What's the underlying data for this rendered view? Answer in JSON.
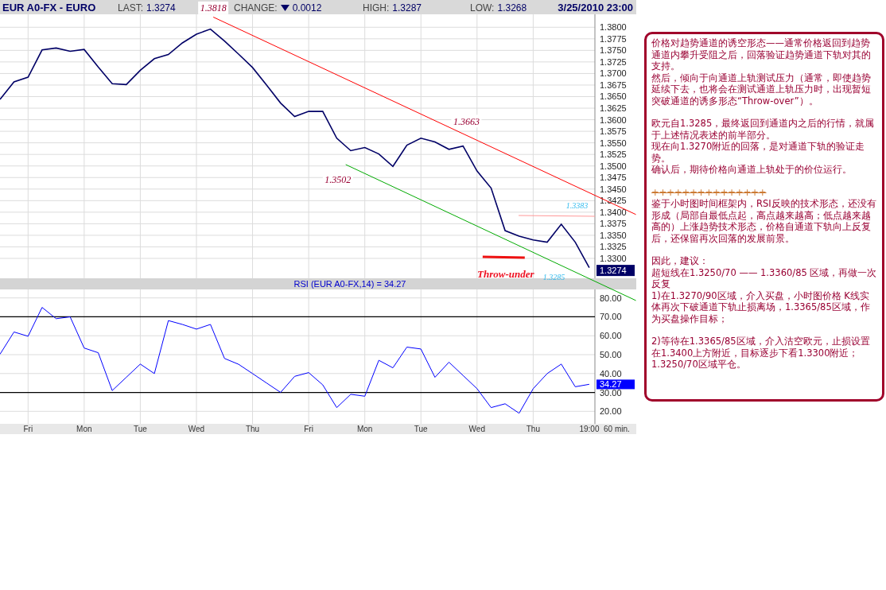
{
  "header": {
    "symbol": "EUR A0-FX - EURO",
    "last_label": "LAST:",
    "last": "1.3274",
    "change_label": "CHANGE:",
    "change": "0.0012",
    "high_label": "HIGH:",
    "high": "1.3287",
    "low_label": "LOW:",
    "low": "1.3268",
    "datetime": "3/25/2010 23:00"
  },
  "price_chart": {
    "last_value": "1.3274",
    "chart_data": {
      "type": "line",
      "categories": [
        null,
        null,
        null,
        null,
        null,
        null,
        null,
        null,
        null,
        null,
        null,
        null,
        null,
        null,
        null,
        null,
        null,
        null,
        null,
        null,
        null,
        null,
        null,
        null,
        null,
        null,
        null,
        null,
        null,
        null,
        null,
        null,
        null,
        null,
        null,
        null,
        null,
        null,
        null,
        null,
        null,
        null,
        null
      ],
      "series": [
        {
          "color": "#000066",
          "values": [
            1.3644,
            1.3682,
            1.3692,
            1.3751,
            1.3755,
            1.3748,
            1.3752,
            1.3714,
            1.3678,
            1.3676,
            1.3707,
            1.3732,
            1.3741,
            1.3766,
            1.3785,
            1.3796,
            1.377,
            1.3742,
            1.3713,
            1.3675,
            1.3636,
            1.3607,
            1.3618,
            1.3618,
            1.356,
            1.3533,
            1.354,
            1.3526,
            1.3499,
            1.3545,
            1.356,
            1.3552,
            1.3536,
            1.3543,
            1.3489,
            1.3452,
            1.336,
            1.3348,
            1.334,
            1.3335,
            1.3374,
            1.3335,
            1.328
          ]
        }
      ],
      "ylim": [
        1.3257,
        1.3828
      ],
      "grid": true,
      "yticks": [
        {
          "value": 1.33,
          "label": "1.3300"
        },
        {
          "value": 1.3325,
          "label": "1.3325"
        },
        {
          "value": 1.335,
          "label": "1.3350"
        },
        {
          "value": 1.3375,
          "label": "1.3375"
        },
        {
          "value": 1.34,
          "label": "1.3400"
        },
        {
          "value": 1.3425,
          "label": "1.3425"
        },
        {
          "value": 1.345,
          "label": "1.3450"
        },
        {
          "value": 1.3475,
          "label": "1.3475"
        },
        {
          "value": 1.35,
          "label": "1.3500"
        },
        {
          "value": 1.3525,
          "label": "1.3525"
        },
        {
          "value": 1.355,
          "label": "1.3550"
        },
        {
          "value": 1.3575,
          "label": "1.3575"
        },
        {
          "value": 1.36,
          "label": "1.3600"
        },
        {
          "value": 1.3625,
          "label": "1.3625"
        },
        {
          "value": 1.365,
          "label": "1.3650"
        },
        {
          "value": 1.3675,
          "label": "1.3675"
        },
        {
          "value": 1.37,
          "label": "1.3700"
        },
        {
          "value": 1.3725,
          "label": "1.3725"
        },
        {
          "value": 1.375,
          "label": "1.3750"
        },
        {
          "value": 1.3775,
          "label": "1.3775"
        },
        {
          "value": 1.38,
          "label": "1.3800"
        }
      ],
      "annotations": [
        "1.3818",
        "1.3663",
        "1.3502",
        "1.3383",
        "Throw-under",
        "1.3285"
      ]
    },
    "lines": [
      {
        "kind": "trend",
        "color": "#ff0000"
      },
      {
        "kind": "trend",
        "color": "#00aa00"
      },
      {
        "kind": "level",
        "color": "#ff9999"
      },
      {
        "kind": "marker",
        "color": "#ee1111"
      }
    ]
  },
  "rsi_chart": {
    "title": "RSI (EUR A0-FX,14) = 34.27",
    "last_value": "34.27",
    "chart_data": {
      "type": "line",
      "categories": [
        null,
        null,
        "Fri",
        null,
        null,
        null,
        "Mon",
        null,
        null,
        null,
        "Tue",
        null,
        null,
        null,
        "Wed",
        null,
        null,
        null,
        "Thu",
        null,
        null,
        null,
        "Fri",
        null,
        null,
        null,
        "Mon",
        null,
        null,
        null,
        "Tue",
        null,
        null,
        null,
        "Wed",
        null,
        null,
        null,
        "Thu",
        null,
        null,
        null,
        "19:00"
      ],
      "series": [
        {
          "color": "#0000ff",
          "values": [
            50.2,
            62,
            59.7,
            75,
            69,
            70,
            53.5,
            51,
            31,
            38,
            45,
            40,
            68,
            66,
            63.5,
            66,
            48,
            44.9,
            40,
            35,
            30,
            38.5,
            40.5,
            34,
            22,
            29,
            28,
            47,
            43,
            54,
            53,
            38,
            46,
            39,
            32,
            22,
            24,
            19,
            32,
            40,
            45,
            33,
            34.3
          ]
        }
      ],
      "ylim": [
        13.4,
        84.5
      ],
      "grid": true,
      "yticks": [
        {
          "value": 20,
          "label": "20.00"
        },
        {
          "value": 30,
          "label": "30.00"
        },
        {
          "value": 40,
          "label": "40.00"
        },
        {
          "value": 50,
          "label": "50.00"
        },
        {
          "value": 60,
          "label": "60.00"
        },
        {
          "value": 70,
          "label": "70.00"
        },
        {
          "value": 80,
          "label": "80.00"
        }
      ]
    },
    "interval": "60 min."
  },
  "commentary": [
    {
      "kind": "text",
      "gap_before": false,
      "text": "价格对趋势通道的诱空形态——通常价格返回到趋势通道内攀升受阻之后，回落验证趋势通道下轨对其的支持。"
    },
    {
      "kind": "text",
      "gap_before": false,
      "text": "然后，倾向于向通道上轨测试压力（通常，即使趋势延续下去，也将会在测试通道上轨压力时，出现暂短突破通道的诱多形态“Throw-over”）。"
    },
    {
      "kind": "text",
      "gap_before": true,
      "text": "欧元自1.3285，最终返回到通道内之后的行情，就属于上述情况表述的前半部分。"
    },
    {
      "kind": "text",
      "gap_before": false,
      "text": "现在向1.3270附近的回落，是对通道下轨的验证走势。"
    },
    {
      "kind": "text",
      "gap_before": false,
      "text": "确认后，期待价格向通道上轨处于的价位运行。"
    },
    {
      "kind": "separator",
      "gap_before": true,
      "text": "+++++++++++++++"
    },
    {
      "kind": "text",
      "gap_before": false,
      "text": "鉴于小时图时间框架内，RSI反映的技术形态，还没有形成（局部自最低点起，高点越来越高；低点越来越高的）上涨趋势技术形态，价格自通道下轨向上反复后，还保留再次回落的发展前景。"
    },
    {
      "kind": "text",
      "gap_before": true,
      "text": "因此，建议："
    },
    {
      "kind": "text",
      "gap_before": false,
      "text": "超短线在1.3250/70 —— 1.3360/85 区域，再做一次反复"
    },
    {
      "kind": "text",
      "gap_before": false,
      "text": "1)在1.3270/90区域，介入买盘，小时图价格 K线实体再次下破通道下轨止损离场，1.3365/85区域，作为买盘操作目标；"
    },
    {
      "kind": "text",
      "gap_before": true,
      "text": "2)等待在1.3365/85区域，介入沽空欧元，止损设置在1.3400上方附近，目标逐步下看1.3300附近；1.3250/70区域平仓。"
    }
  ]
}
